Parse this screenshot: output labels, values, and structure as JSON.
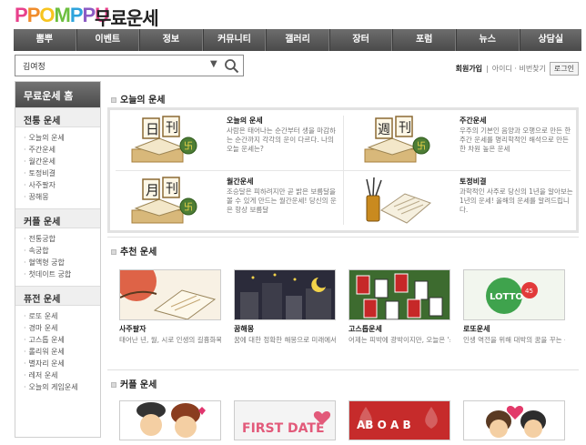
{
  "header": {
    "logo_letters": [
      "P",
      "P",
      "O",
      "M",
      "P",
      "P",
      "U"
    ],
    "logo_colors": [
      "#e8418c",
      "#f08c2c",
      "#f7c41f",
      "#6cbf3f",
      "#2ea3dc",
      "#8c5bc4",
      "#e8418c"
    ],
    "site_title": "무료운세"
  },
  "nav": {
    "items": [
      "뽐뿌",
      "이벤트",
      "정보",
      "커뮤니티",
      "갤러리",
      "장터",
      "포럼",
      "뉴스",
      "상담실"
    ]
  },
  "search": {
    "value": "김여정"
  },
  "login": {
    "join": "회원가입",
    "sep": "|",
    "find": "아이디 · 비번찾기",
    "login_button": "로그인"
  },
  "sidebar": {
    "title": "무료운세 홈",
    "sections": [
      {
        "title": "전통 운세",
        "items": [
          "오늘의 운세",
          "주간운세",
          "월간운세",
          "토정비결",
          "사주팔자",
          "꿈해몽"
        ]
      },
      {
        "title": "커플 운세",
        "items": [
          "전통궁합",
          "속궁합",
          "혈액형 궁합",
          "첫데이트 궁합"
        ]
      },
      {
        "title": "퓨전 운세",
        "items": [
          "로또 운세",
          "경마 운세",
          "고스톱 운세",
          "롤리워 운세",
          "별자리 운세",
          "레저 운세",
          "오늘의 게임운세"
        ]
      }
    ]
  },
  "today": {
    "section_title": "오늘의 운세",
    "items": [
      {
        "title": "오늘의 운세",
        "desc": "사람은 태어나는 순간부터 생을 마감하는 순간까지 각각의 운이 다르다. 나의 오늘 운세는?",
        "badge": "日"
      },
      {
        "title": "주간운세",
        "desc": "우주의 기본인 음양과 오행으로 만든 한 주간 운세를 명리학적인 해석으로 만든 한 차원 높은 운세",
        "badge": "週"
      },
      {
        "title": "월간운세",
        "desc": "조승달은 피하려지만 곧 밝은 보름달을 볼 수 있게 만드는 월간운세! 당신의 운은 항상 보름달",
        "badge": "月"
      },
      {
        "title": "토정비결",
        "desc": "과학적인 사주로 당신의 1년을 알아보는 1년의 운세! 올해의 운세를 알려드립니다.",
        "badge": ""
      }
    ]
  },
  "recommend": {
    "section_title": "추천 운세",
    "cards": [
      {
        "title": "사주팔자",
        "desc": "태어난 년, 월, 시로 인생의 길흉화복을 할아 미리 준비하세요!"
      },
      {
        "title": "꿈해몽",
        "desc": "꿈에 대한 정확한 해몽으로 미래에서 온 메세지를 확인해 보세요!"
      },
      {
        "title": "고스톱운세",
        "desc": "어제는 피박에 광박이지만, 오늘은 '쓰리고' 인생을 기대하세요."
      },
      {
        "title": "로또운세",
        "desc": "인생 역전을 위해 대박의 꿈을 꾸는 분들의 운세를 알려드려요."
      }
    ],
    "lotto_text": "LOTTO",
    "lotto_number": "45"
  },
  "couple": {
    "section_title": "커플 운세",
    "first_date_text": "FIRST DATE",
    "blood_text": "AB O A B"
  }
}
